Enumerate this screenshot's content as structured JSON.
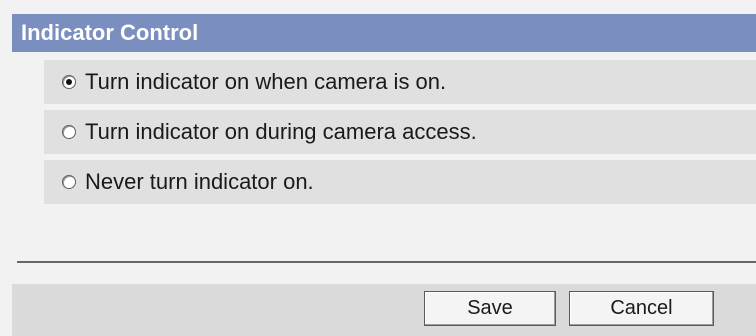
{
  "panel": {
    "title": "Indicator Control"
  },
  "options": [
    {
      "label": "Turn indicator on when camera is on.",
      "checked": true
    },
    {
      "label": "Turn indicator on during camera access.",
      "checked": false
    },
    {
      "label": "Never turn indicator on.",
      "checked": false
    }
  ],
  "buttons": {
    "save_label": "Save",
    "cancel_label": "Cancel"
  }
}
